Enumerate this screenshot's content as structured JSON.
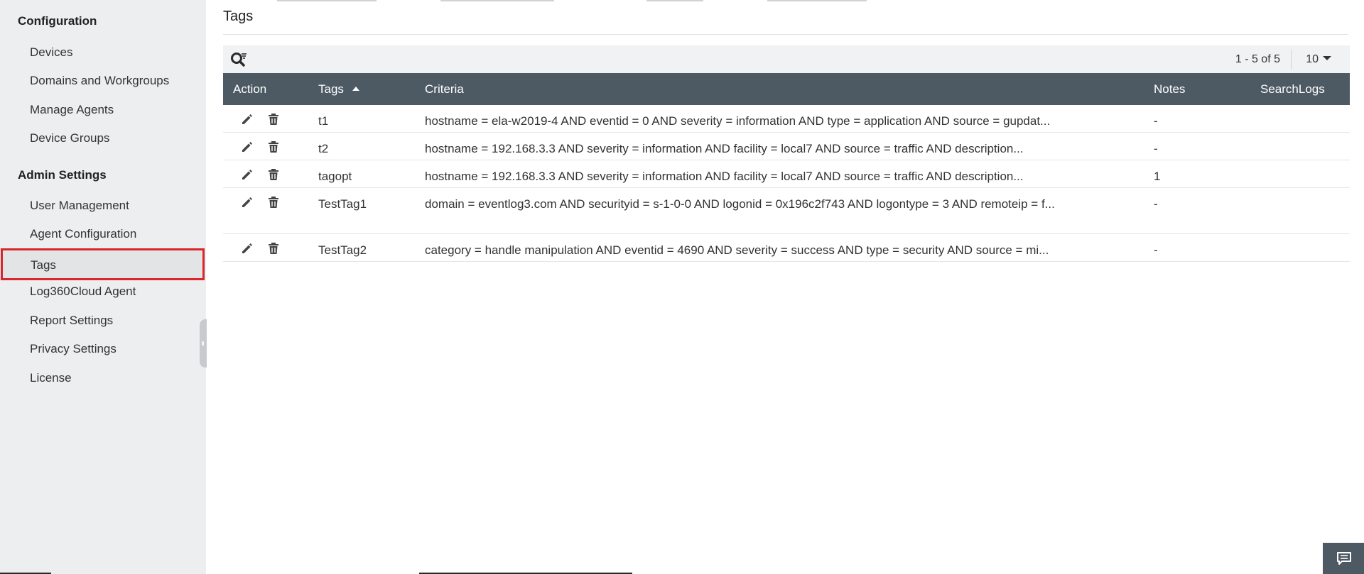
{
  "sidebar": {
    "sections": [
      {
        "title": "Configuration",
        "items": [
          "Devices",
          "Domains and Workgroups",
          "Manage Agents",
          "Device Groups"
        ]
      },
      {
        "title": "Admin Settings",
        "items": [
          "User Management",
          "Agent Configuration",
          "Tags",
          "Log360Cloud Agent",
          "Report Settings",
          "Privacy Settings",
          "License"
        ]
      }
    ],
    "active_item": "Tags"
  },
  "page": {
    "title": "Tags"
  },
  "toolbar": {
    "search_icon": "search-filter-icon",
    "pager_text": "1 - 5 of 5",
    "page_size": "10"
  },
  "table": {
    "columns": {
      "action": "Action",
      "tags": "Tags",
      "criteria": "Criteria",
      "notes": "Notes",
      "searchlogs": "SearchLogs"
    },
    "sort": {
      "column": "tags",
      "direction": "ascending"
    },
    "rows": [
      {
        "tag": "t1",
        "criteria": "hostname = ela-w2019-4 AND eventid = 0 AND severity = information AND type = application AND source = gupdat...",
        "notes": "-"
      },
      {
        "tag": "t2",
        "criteria": "hostname = 192.168.3.3 AND severity = information AND facility = local7 AND source = traffic AND description...",
        "notes": "-"
      },
      {
        "tag": "tagopt",
        "criteria": "hostname = 192.168.3.3 AND severity = information AND facility = local7 AND source = traffic AND description...",
        "notes": "1"
      },
      {
        "tag": "TestTag1",
        "criteria": "domain = eventlog3.com AND securityid = s-1-0-0 AND logonid = 0x196c2f743 AND logontype = 3 AND remoteip = f...",
        "notes": "-"
      },
      {
        "tag": "TestTag2",
        "criteria": "category = handle manipulation AND eventid = 4690 AND severity = success AND type = security AND source = mi...",
        "notes": "-"
      }
    ]
  },
  "icons": {
    "edit": "pencil-icon",
    "delete": "trash-icon",
    "chat": "chat-icon"
  },
  "colors": {
    "sidebar_bg": "#eceeef",
    "header_bg": "#4d5a64",
    "active_outline": "#d9262c",
    "toolbar_bg": "#f1f2f3"
  }
}
